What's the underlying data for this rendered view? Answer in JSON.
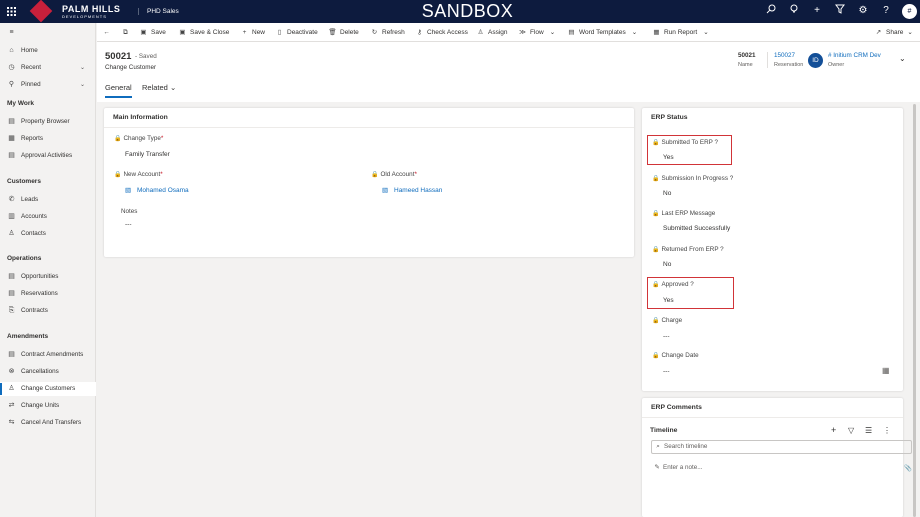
{
  "topbar": {
    "brand_line1": "PALM HILLS",
    "brand_line2": "DEVELOPMENTS",
    "app_name": "PHD Sales",
    "environment": "SANDBOX",
    "user_initial": "#",
    "icons": [
      "search-icon",
      "lightbulb-icon",
      "plus-icon",
      "filter-icon",
      "gear-icon",
      "help-icon"
    ]
  },
  "sidebar": {
    "top": [
      {
        "label": "Home",
        "icon": "home-icon"
      },
      {
        "label": "Recent",
        "icon": "clock-icon",
        "chevron": true
      },
      {
        "label": "Pinned",
        "icon": "pin-icon",
        "chevron": true
      }
    ],
    "groups": [
      {
        "title": "My Work",
        "items": [
          "Property Browser",
          "Reports",
          "Approval Activities"
        ]
      },
      {
        "title": "Customers",
        "items": [
          "Leads",
          "Accounts",
          "Contacts"
        ]
      },
      {
        "title": "Operations",
        "items": [
          "Opportunities",
          "Reservations",
          "Contracts"
        ]
      },
      {
        "title": "Amendments",
        "items": [
          "Contract Amendments",
          "Cancellations",
          "Change Customers",
          "Change Units",
          "Cancel And Transfers"
        ]
      }
    ],
    "active_item": "Change Customers"
  },
  "commandbar": {
    "save": "Save",
    "save_close": "Save & Close",
    "new": "New",
    "deactivate": "Deactivate",
    "delete": "Delete",
    "refresh": "Refresh",
    "check_access": "Check Access",
    "assign": "Assign",
    "flow": "Flow",
    "word_templates": "Word Templates",
    "run_report": "Run Report",
    "share": "Share"
  },
  "record": {
    "id": "50021",
    "saved": "- Saved",
    "entity": "Change Customer",
    "tabs": {
      "general": "General",
      "related": "Related"
    },
    "header_fields": {
      "name_value": "50021",
      "name_label": "Name",
      "reservation_value": "150027",
      "reservation_label": "Reservation",
      "owner_initials": "ID",
      "owner_value": "# Initium CRM Dev",
      "owner_label": "Owner"
    }
  },
  "main_info": {
    "title": "Main Information",
    "change_type_label": "Change Type",
    "change_type_value": "Family Transfer",
    "new_account_label": "New Account",
    "new_account_value": "Mohamed Osama",
    "old_account_label": "Old Account",
    "old_account_value": "Hameed Hassan",
    "notes_label": "Notes",
    "notes_value": "---"
  },
  "erp_status": {
    "title": "ERP Status",
    "fields": [
      {
        "label": "Submitted To ERP ?",
        "value": "Yes"
      },
      {
        "label": "Submission In Progress ?",
        "value": "No"
      },
      {
        "label": "Last ERP Message",
        "value": "Submitted Successfully"
      },
      {
        "label": "Returned From ERP ?",
        "value": "No"
      },
      {
        "label": "Approved ?",
        "value": "Yes"
      },
      {
        "label": "Charge",
        "value": "---"
      },
      {
        "label": "Change Date",
        "value": "---"
      }
    ]
  },
  "erp_comments": {
    "title": "ERP Comments",
    "timeline_label": "Timeline",
    "search_placeholder": "Search timeline",
    "note_placeholder": "Enter a note..."
  },
  "colors": {
    "topbar": "#0d1b3e",
    "brand": "#c8203b",
    "link": "#0f6cbd",
    "highlight": "#d13438"
  }
}
